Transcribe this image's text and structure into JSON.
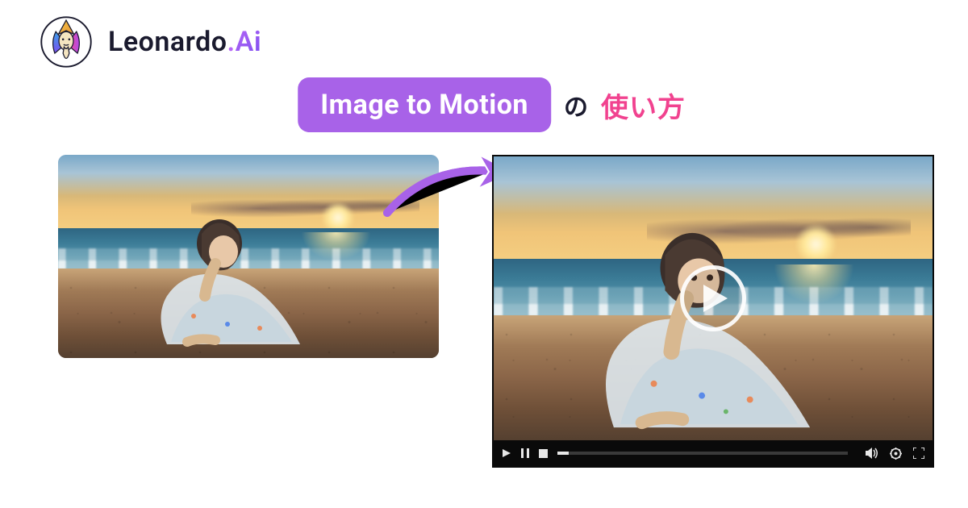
{
  "brand": {
    "name_primary": "Leonardo",
    "name_dot": ".",
    "name_accent": "Ai"
  },
  "title": {
    "chip": "Image to Motion",
    "suffix_particle": "の",
    "suffix_pink": "使い方"
  },
  "arrow": {
    "color": "#a862e8"
  },
  "video": {
    "play_icon": "play-icon",
    "progress_percent": 4,
    "controls": {
      "play": "play-icon",
      "pause": "pause-icon",
      "stop": "stop-icon",
      "volume": "volume-icon",
      "settings": "gear-icon",
      "fullscreen": "fullscreen-icon"
    }
  },
  "colors": {
    "chip_bg": "#a862e8",
    "pink": "#f1428f",
    "brand_dark": "#1a1a2e"
  }
}
